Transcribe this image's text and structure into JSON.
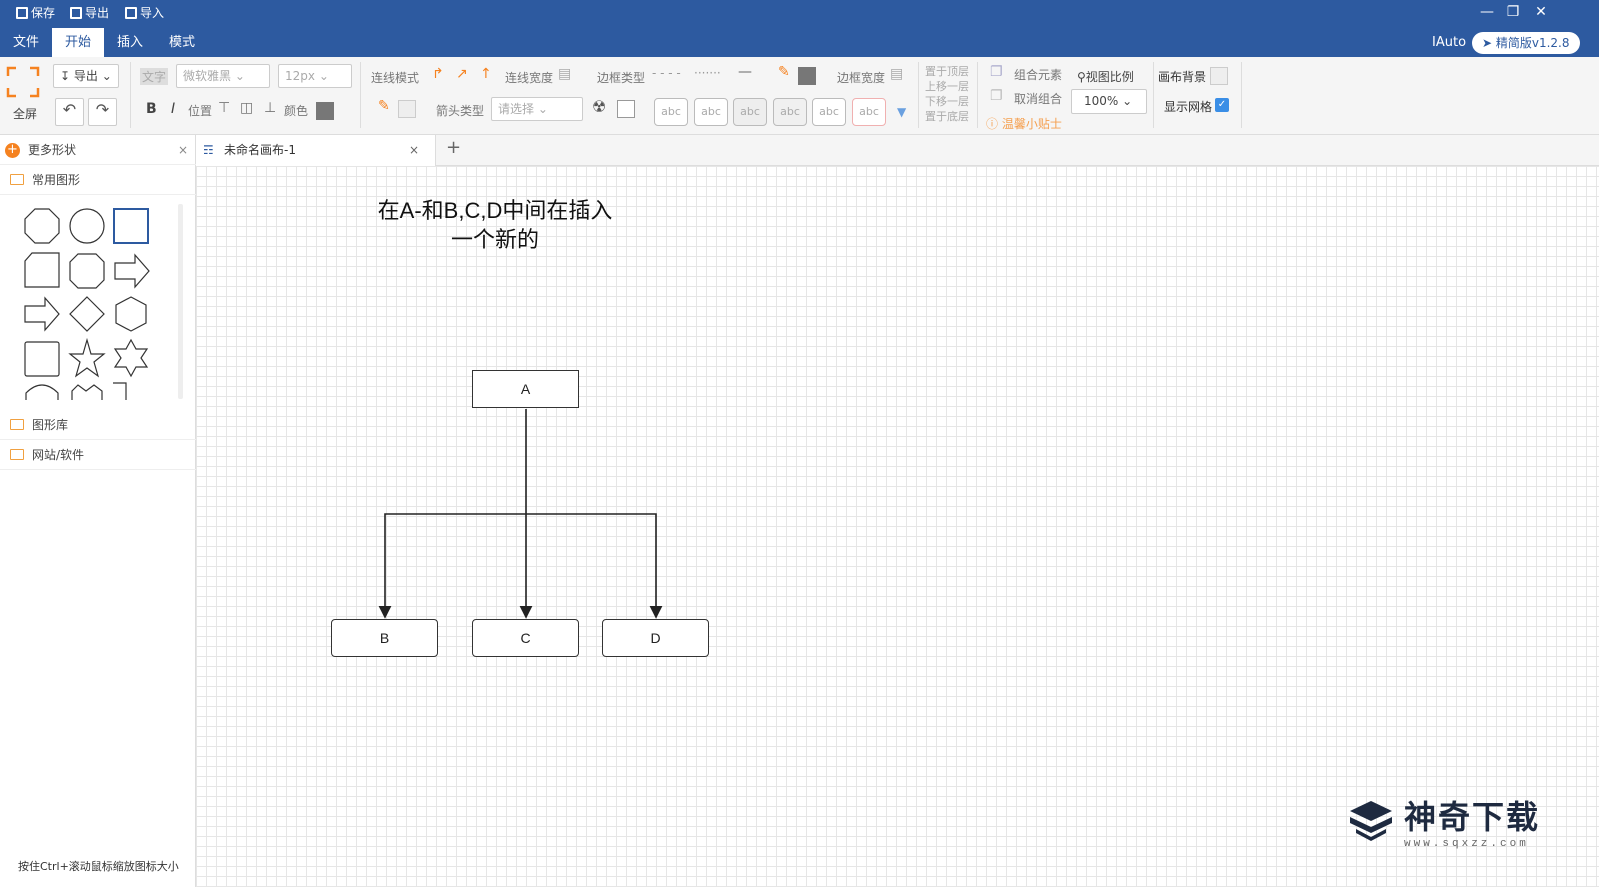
{
  "titlebar": {
    "save": "保存",
    "export": "导出",
    "import": "导入",
    "tabs": [
      "文件",
      "开始",
      "插入",
      "模式"
    ],
    "user": "IAuto",
    "version": "精简版v1.2.8"
  },
  "ribbon": {
    "fullscreen": "全屏",
    "export": "导出",
    "text_label": "文字",
    "font": "微软雅黑",
    "font_size": "12px",
    "bold": "B",
    "italic": "I",
    "position": "位置",
    "color": "颜色",
    "line_style": "连线模式",
    "line_width": "连线宽度",
    "border_type": "边框类型",
    "border_width": "边框宽度",
    "arrow_type": "箭头类型",
    "arrow_placeholder": "请选择",
    "abc": "abc",
    "layer_top": "置于顶层",
    "layer_up": "上移一层",
    "layer_down": "下移一层",
    "layer_bottom": "置于底层",
    "group": "组合元素",
    "ungroup": "取消组合",
    "tips": "温馨小贴士",
    "view_ratio": "视图比例",
    "zoom": "100%",
    "canvas_bg": "画布背景",
    "show_grid": "显示网格"
  },
  "sidebar": {
    "more_shapes": "更多形状",
    "common_shapes": "常用图形",
    "library": "图形库",
    "web_software": "网站/软件",
    "hint": "按住Ctrl+滚动鼠标缩放图标大小"
  },
  "canvas": {
    "tab_title": "未命名画布-1",
    "add_tab": "+",
    "note_line1": "在A-和B,C,D中间在插入",
    "note_line2": "一个新的",
    "nodes": [
      "A",
      "B",
      "C",
      "D"
    ]
  },
  "watermark": {
    "title": "神奇下载",
    "url": "www.sqxzz.com"
  },
  "colors": {
    "brand": "#2d5aa0",
    "accent_orange": "#f58220"
  }
}
